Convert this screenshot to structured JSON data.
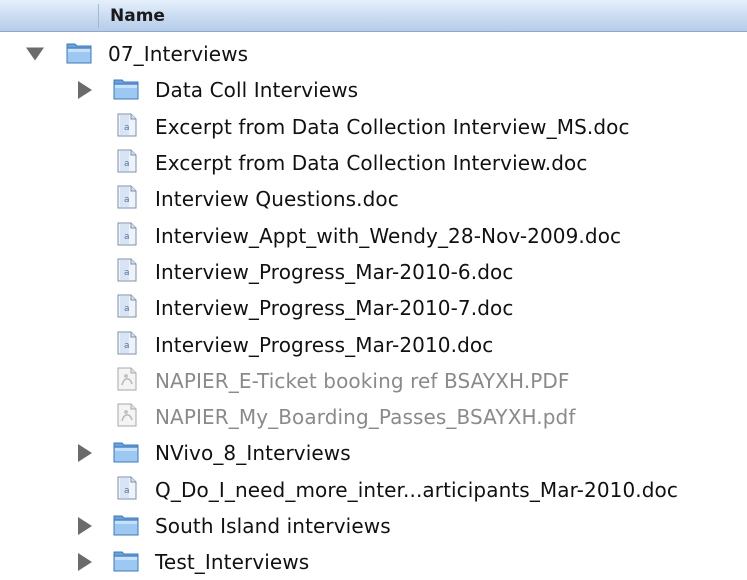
{
  "header": {
    "name_label": "Name"
  },
  "root": {
    "label": "07_Interviews",
    "icon": "folder-icon",
    "expanded": true
  },
  "items": [
    {
      "label": "Data Coll Interviews",
      "icon": "folder-icon",
      "type": "folder",
      "expanded": false,
      "dimmed": false
    },
    {
      "label": "Excerpt from Data Collection Interview_MS.doc",
      "icon": "document-icon",
      "type": "doc",
      "dimmed": false
    },
    {
      "label": "Excerpt from Data Collection Interview.doc",
      "icon": "document-icon",
      "type": "doc",
      "dimmed": false
    },
    {
      "label": "Interview Questions.doc",
      "icon": "document-icon",
      "type": "doc",
      "dimmed": false
    },
    {
      "label": "Interview_Appt_with_Wendy_28-Nov-2009.doc",
      "icon": "document-icon",
      "type": "doc",
      "dimmed": false
    },
    {
      "label": "Interview_Progress_Mar-2010-6.doc",
      "icon": "document-icon",
      "type": "doc",
      "dimmed": false
    },
    {
      "label": "Interview_Progress_Mar-2010-7.doc",
      "icon": "document-icon",
      "type": "doc",
      "dimmed": false
    },
    {
      "label": "Interview_Progress_Mar-2010.doc",
      "icon": "document-icon",
      "type": "doc",
      "dimmed": false
    },
    {
      "label": "NAPIER_E-Ticket booking ref BSAYXH.PDF",
      "icon": "pdf-icon",
      "type": "pdf",
      "dimmed": true
    },
    {
      "label": "NAPIER_My_Boarding_Passes_BSAYXH.pdf",
      "icon": "pdf-icon",
      "type": "pdf",
      "dimmed": true
    },
    {
      "label": "NVivo_8_Interviews",
      "icon": "folder-icon",
      "type": "folder",
      "expanded": false,
      "dimmed": false
    },
    {
      "label": "Q_Do_I_need_more_inter...articipants_Mar-2010.doc",
      "icon": "document-icon",
      "type": "doc",
      "dimmed": false
    },
    {
      "label": "South Island interviews",
      "icon": "folder-icon",
      "type": "folder",
      "expanded": false,
      "dimmed": false
    },
    {
      "label": "Test_Interviews",
      "icon": "folder-icon",
      "type": "folder",
      "expanded": false,
      "dimmed": false
    }
  ],
  "colors": {
    "header_top": "#e6f0fb",
    "header_bottom": "#b6cde9",
    "folder": "#7fb2e8",
    "dimmed_text": "#8a8a8a"
  }
}
